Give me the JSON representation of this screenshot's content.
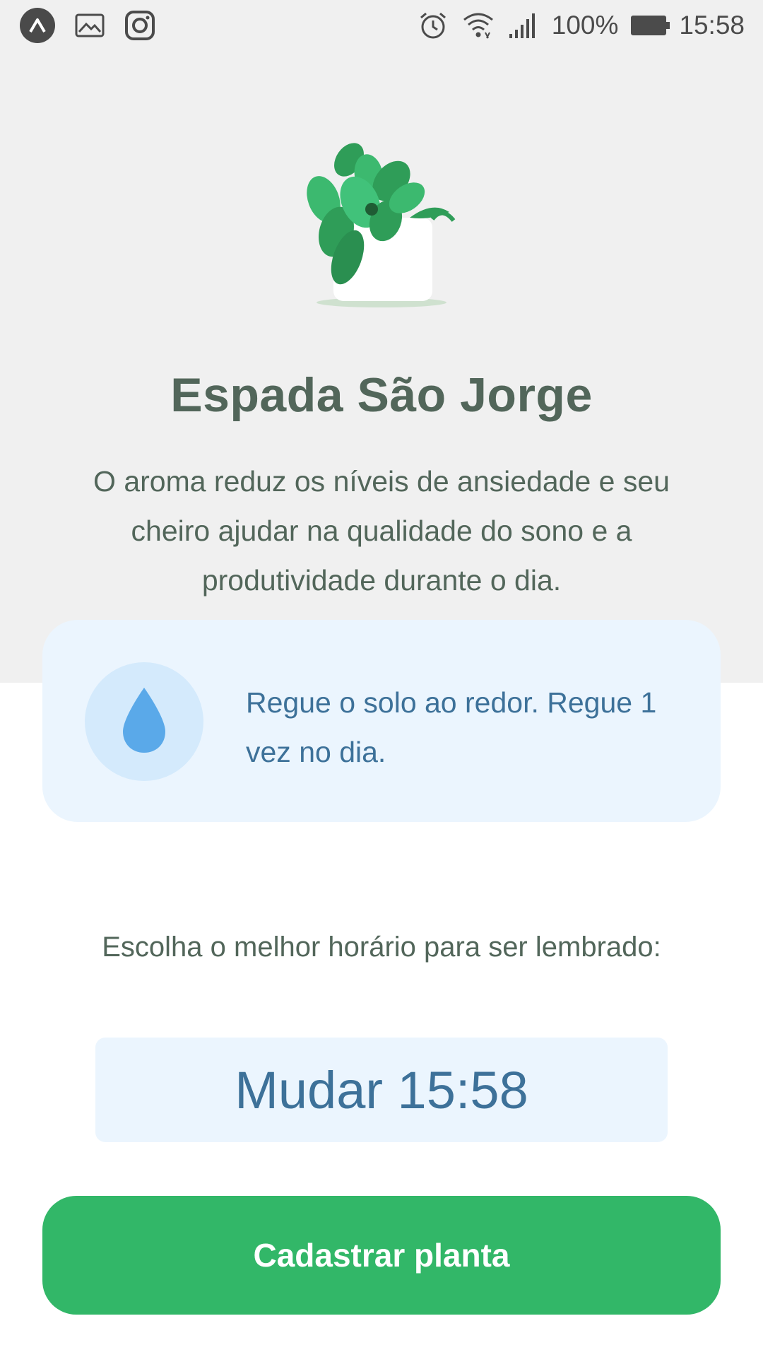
{
  "status_bar": {
    "icons_left": [
      "app-a-icon",
      "gallery-icon",
      "instagram-icon"
    ],
    "icons_right": [
      "alarm-icon",
      "wifi-icon",
      "signal-icon",
      "battery-icon"
    ],
    "battery": "100%",
    "time": "15:58"
  },
  "plant": {
    "name": "Espada São Jorge",
    "about": "O aroma reduz os níveis de ansiedade e seu cheiro ajudar na qualidade do sono e a produtividade durante o dia."
  },
  "water_tip": {
    "icon": "water-drop-icon",
    "text": "Regue o solo ao redor. Regue 1 vez no dia."
  },
  "reminder": {
    "label": "Escolha o melhor horário para ser lembrado:",
    "time_button": "Mudar 15:58"
  },
  "actions": {
    "save_label": "Cadastrar planta"
  },
  "colors": {
    "heading": "#52665a",
    "blue_text": "#3d7199",
    "card_bg": "#ebf5fe",
    "green": "#32b768"
  }
}
